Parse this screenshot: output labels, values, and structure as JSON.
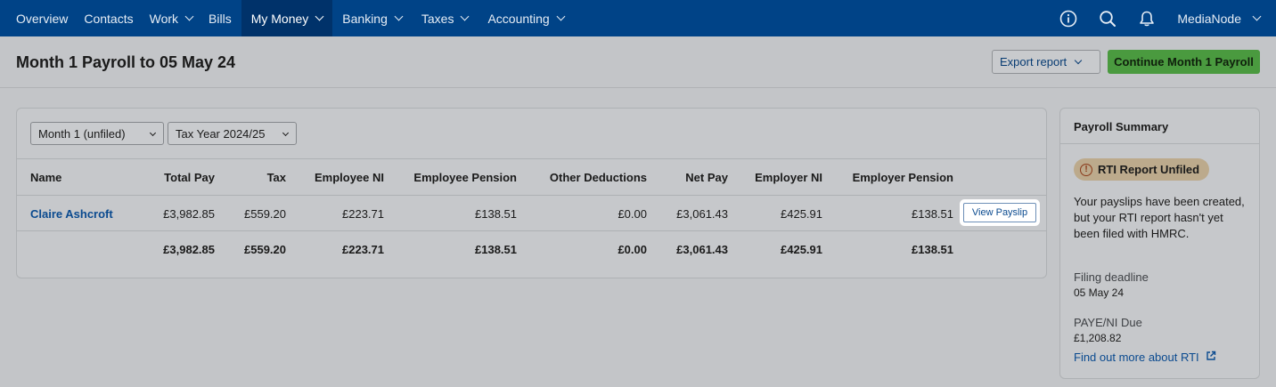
{
  "nav": {
    "items": [
      {
        "label": "Overview",
        "has_menu": false
      },
      {
        "label": "Contacts",
        "has_menu": false
      },
      {
        "label": "Work",
        "has_menu": true
      },
      {
        "label": "Bills",
        "has_menu": false
      },
      {
        "label": "My Money",
        "has_menu": true,
        "active": true
      },
      {
        "label": "Banking",
        "has_menu": true
      },
      {
        "label": "Taxes",
        "has_menu": true
      },
      {
        "label": "Accounting",
        "has_menu": true
      }
    ],
    "user": "MediaNode",
    "icons": [
      "info-icon",
      "search-icon",
      "bell-icon"
    ]
  },
  "header": {
    "title": "Month 1 Payroll to 05 May 24",
    "export_label": "Export report",
    "continue_label": "Continue Month 1 Payroll"
  },
  "filters": {
    "period": "Month 1 (unfiled)",
    "tax_year": "Tax Year 2024/25"
  },
  "table": {
    "columns": [
      "Name",
      "Total Pay",
      "Tax",
      "Employee NI",
      "Employee Pension",
      "Other Deductions",
      "Net Pay",
      "Employer NI",
      "Employer Pension"
    ],
    "rows": [
      {
        "name": "Claire Ashcroft",
        "cells": [
          "£3,982.85",
          "£559.20",
          "£223.71",
          "£138.51",
          "£0.00",
          "£3,061.43",
          "£425.91",
          "£138.51"
        ],
        "action": "View Payslip"
      }
    ],
    "totals": [
      "£3,982.85",
      "£559.20",
      "£223.71",
      "£138.51",
      "£0.00",
      "£3,061.43",
      "£425.91",
      "£138.51"
    ]
  },
  "summary": {
    "title": "Payroll Summary",
    "badge": "RTI Report Unfiled",
    "badge_icon_glyph": "!",
    "message": "Your payslips have been created, but your RTI report hasn't yet been filed with HMRC.",
    "deadline_label": "Filing deadline",
    "deadline_value": "05 May 24",
    "due_label": "PAYE/NI Due",
    "due_value": "£1,208.82",
    "link": "Find out more about RTI"
  },
  "colors": {
    "nav_bg": "#004387",
    "continue_button": "#4a9a3f",
    "link": "#0a4a8f",
    "badge_bg": "#bcaa8c"
  }
}
